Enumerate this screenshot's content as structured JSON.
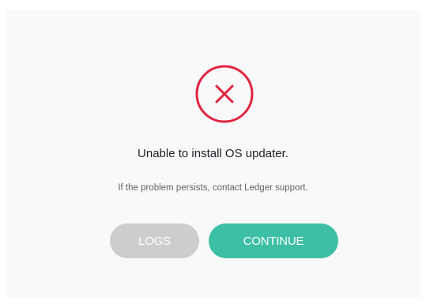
{
  "dialog": {
    "error_message": "Unable to install OS updater.",
    "hint": "If the problem persists, contact Ledger support.",
    "icon": "error-x-icon",
    "icon_color": "#e1233f"
  },
  "buttons": {
    "logs_label": "LOGS",
    "continue_label": "CONTINUE"
  },
  "colors": {
    "panel_bg": "#f9f9f9",
    "continue_bg": "#3dbfa5",
    "logs_bg": "#cdcdcd"
  }
}
